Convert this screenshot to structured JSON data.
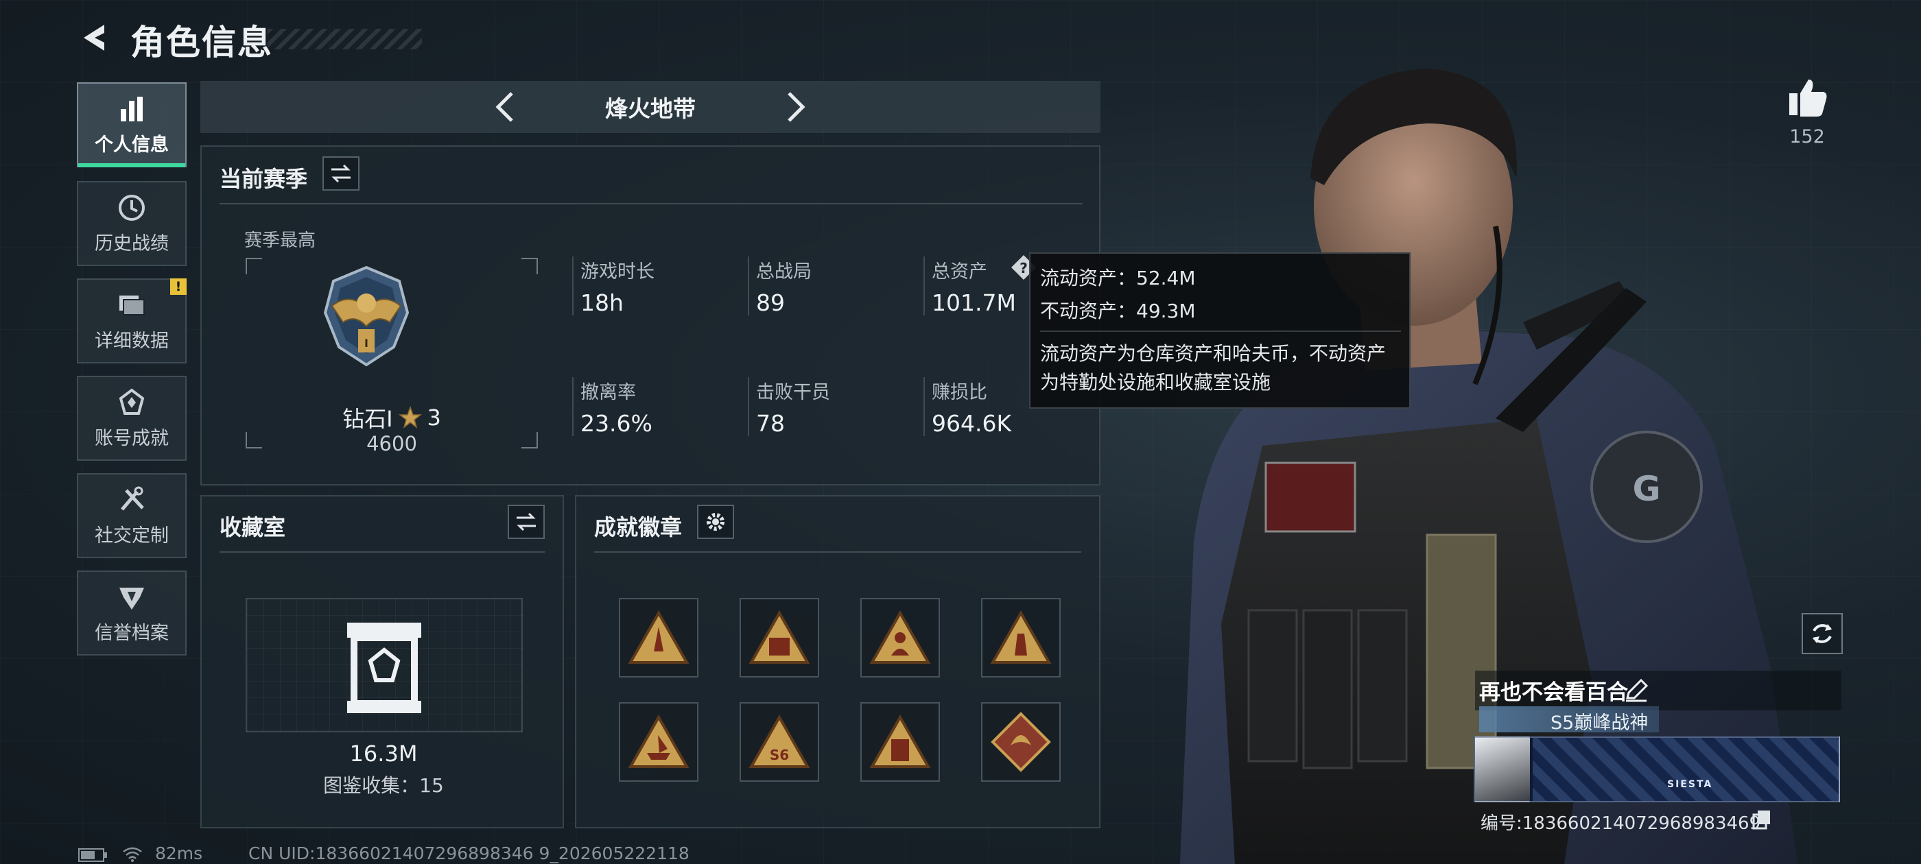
{
  "header": {
    "title": "角色信息"
  },
  "sidebar": {
    "items": [
      {
        "label": "个人信息",
        "icon": "bar-chart-icon"
      },
      {
        "label": "历史战绩",
        "icon": "history-clock-icon"
      },
      {
        "label": "详细数据",
        "icon": "folder-icon",
        "badge": "!"
      },
      {
        "label": "账号成就",
        "icon": "achievement-icon"
      },
      {
        "label": "社交定制",
        "icon": "tools-icon"
      },
      {
        "label": "信誉档案",
        "icon": "reputation-icon"
      }
    ]
  },
  "map": {
    "name": "烽火地带"
  },
  "season": {
    "title": "当前赛季",
    "best_label": "赛季最高",
    "rank_name": "钻石Ⅰ",
    "rank_stars": "3",
    "rank_points": "4600",
    "stats": [
      {
        "label": "游戏时长",
        "value": "18h"
      },
      {
        "label": "总战局",
        "value": "89"
      },
      {
        "label": "总资产",
        "value": "101.7M"
      },
      {
        "label": "撤离率",
        "value": "23.6%"
      },
      {
        "label": "击败干员",
        "value": "78"
      },
      {
        "label": "赚损比",
        "value": "964.6K"
      }
    ]
  },
  "tooltip": {
    "liquid": "流动资产：52.4M",
    "fixed": "不动资产：49.3M",
    "desc_line1": "流动资产为仓库资产和哈夫币，不动资产",
    "desc_line2": "为特勤处设施和收藏室设施"
  },
  "collection": {
    "title": "收藏室",
    "value": "16.3M",
    "catalog": "图鉴收集：15"
  },
  "achievements": {
    "title": "成就徽章",
    "badges": [
      "badge-rocket-icon",
      "badge-crate-icon",
      "badge-operator-icon",
      "badge-soldier-icon",
      "badge-ship-icon",
      "badge-s6-icon",
      "badge-s7-icon",
      "badge-dragon-icon"
    ]
  },
  "likes": {
    "count": "152"
  },
  "player": {
    "name": "再也不会看百合",
    "title": "S5巅峰战神",
    "banner_text": "SIESTA",
    "id_label": "编号:1836602140729689834​69"
  },
  "status_bar": {
    "ping": "82ms",
    "uid": "CN UID:18366021407296898346 9_202605222118"
  },
  "colors": {
    "accent": "#3fd8a0",
    "warning": "#e8c13a",
    "gold": "#c9a052"
  }
}
